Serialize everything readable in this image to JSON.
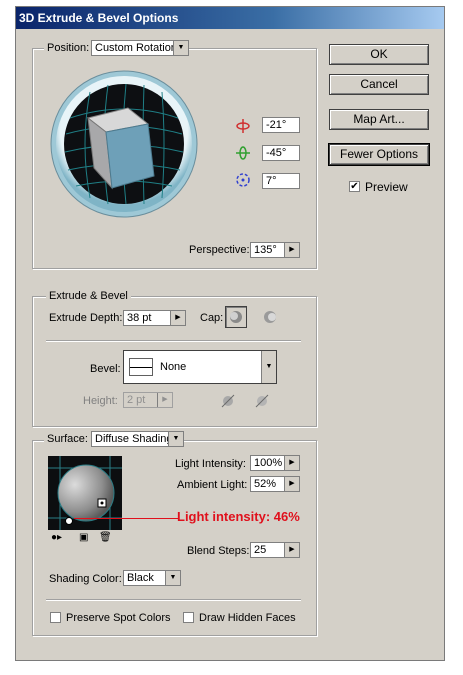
{
  "window": {
    "title": "3D Extrude & Bevel Options"
  },
  "buttons": {
    "ok": "OK",
    "cancel": "Cancel",
    "map_art": "Map Art...",
    "fewer_options": "Fewer Options"
  },
  "preview": {
    "label": "Preview",
    "checked": true,
    "check_glyph": "✔"
  },
  "position": {
    "label": "Position:",
    "value": "Custom Rotation",
    "rot_x": "-21°",
    "rot_y": "-45°",
    "rot_z": "7°",
    "perspective_label": "Perspective:",
    "perspective_value": "135°"
  },
  "extrude": {
    "legend": "Extrude & Bevel",
    "depth_label": "Extrude Depth:",
    "depth_value": "38 pt",
    "cap_label": "Cap:",
    "bevel_label": "Bevel:",
    "bevel_value": "None",
    "height_label": "Height:",
    "height_value": "2 pt"
  },
  "surface": {
    "label": "Surface:",
    "value": "Diffuse Shading",
    "light_intensity_label": "Light Intensity:",
    "light_intensity_value": "100%",
    "ambient_light_label": "Ambient Light:",
    "ambient_light_value": "52%",
    "blend_steps_label": "Blend Steps:",
    "blend_steps_value": "25",
    "shading_color_label": "Shading Color:",
    "shading_color_value": "Black",
    "preserve_spot_label": "Preserve Spot Colors",
    "draw_hidden_label": "Draw Hidden Faces"
  },
  "annotation": {
    "text": "Light intensity: 46%",
    "color": "#e0101c"
  },
  "icons": {
    "rot_x": "rotate-x-icon",
    "rot_y": "rotate-y-icon",
    "rot_z": "rotate-z-icon",
    "cap_on": "cap-on-icon",
    "cap_off": "cap-off-icon",
    "bevel_out": "bevel-out-icon",
    "bevel_in": "bevel-in-icon"
  }
}
